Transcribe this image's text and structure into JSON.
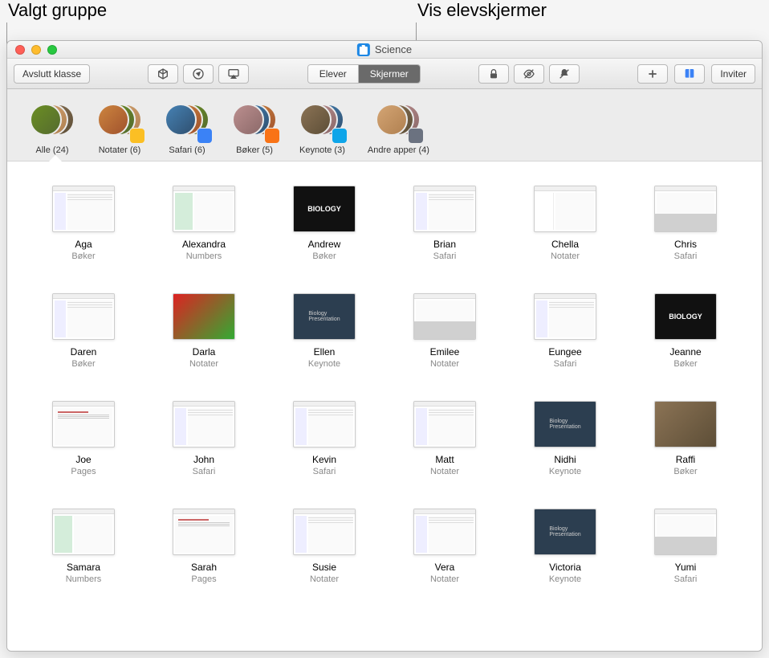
{
  "callouts": {
    "left": "Valgt gruppe",
    "right": "Vis elevskjermer"
  },
  "window": {
    "title": "Science"
  },
  "toolbar": {
    "end_class": "Avslutt klasse",
    "segment": {
      "students": "Elever",
      "screens": "Skjermer"
    },
    "invite": "Inviter"
  },
  "groups": [
    {
      "label": "Alle (24)",
      "badge": null,
      "selected": true
    },
    {
      "label": "Notater (6)",
      "badge": "yellow"
    },
    {
      "label": "Safari (6)",
      "badge": "blue"
    },
    {
      "label": "Bøker (5)",
      "badge": "orange"
    },
    {
      "label": "Keynote (3)",
      "badge": "cyan"
    },
    {
      "label": "Andre apper (4)",
      "badge": "gray"
    }
  ],
  "students": [
    {
      "name": "Aga",
      "app": "Bøker",
      "thumb": "safari"
    },
    {
      "name": "Alexandra",
      "app": "Numbers",
      "thumb": "numbers"
    },
    {
      "name": "Andrew",
      "app": "Bøker",
      "thumb": "biology"
    },
    {
      "name": "Brian",
      "app": "Safari",
      "thumb": "safari"
    },
    {
      "name": "Chella",
      "app": "Notater",
      "thumb": "notes"
    },
    {
      "name": "Chris",
      "app": "Safari",
      "thumb": "kb"
    },
    {
      "name": "Daren",
      "app": "Bøker",
      "thumb": "safari"
    },
    {
      "name": "Darla",
      "app": "Notater",
      "thumb": "photo"
    },
    {
      "name": "Ellen",
      "app": "Keynote",
      "thumb": "keynote"
    },
    {
      "name": "Emilee",
      "app": "Notater",
      "thumb": "kb"
    },
    {
      "name": "Eungee",
      "app": "Safari",
      "thumb": "safari"
    },
    {
      "name": "Jeanne",
      "app": "Bøker",
      "thumb": "biology"
    },
    {
      "name": "Joe",
      "app": "Pages",
      "thumb": "pages"
    },
    {
      "name": "John",
      "app": "Safari",
      "thumb": "safari"
    },
    {
      "name": "Kevin",
      "app": "Safari",
      "thumb": "safari"
    },
    {
      "name": "Matt",
      "app": "Notater",
      "thumb": "safari"
    },
    {
      "name": "Nidhi",
      "app": "Keynote",
      "thumb": "keynote"
    },
    {
      "name": "Raffi",
      "app": "Bøker",
      "thumb": "photo2"
    },
    {
      "name": "Samara",
      "app": "Numbers",
      "thumb": "numbers"
    },
    {
      "name": "Sarah",
      "app": "Pages",
      "thumb": "pages"
    },
    {
      "name": "Susie",
      "app": "Notater",
      "thumb": "safari"
    },
    {
      "name": "Vera",
      "app": "Notater",
      "thumb": "safari"
    },
    {
      "name": "Victoria",
      "app": "Keynote",
      "thumb": "keynote"
    },
    {
      "name": "Yumi",
      "app": "Safari",
      "thumb": "kb"
    }
  ]
}
